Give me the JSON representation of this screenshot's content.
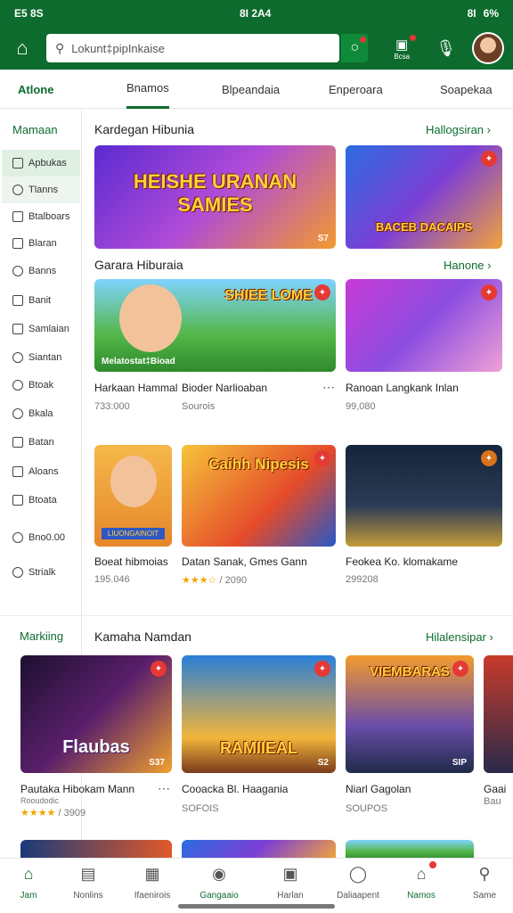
{
  "status": {
    "left": "E5 8S",
    "center": "8I 2A4",
    "right_signal": "8I",
    "battery": "6%"
  },
  "appbar": {
    "search_placeholder": "Lokunt‡pipInkaise",
    "app_label": "Bcsa"
  },
  "tabs": [
    "Atlone",
    "Bnamos",
    "Blpeandaia",
    "Enperoara",
    "Soapekaa"
  ],
  "sidebar": {
    "title": "Mamaan",
    "items": [
      "Apbukas",
      "Tlanns",
      "Btalboars",
      "Blaran",
      "Banns",
      "Banit",
      "Samlaian",
      "Siantan",
      "Btoak",
      "Bkala",
      "Batan",
      "Aloans",
      "Btoata",
      "Bno0.00",
      "Strialk"
    ],
    "bottom_title": "Markiing"
  },
  "sections": {
    "s1": {
      "title": "Kardegan Hibunia",
      "link": "Hallogsiran"
    },
    "s2": {
      "title": "Garara Hiburaia",
      "link": "Hanone"
    },
    "s3": {
      "title": "Kamaha Namdan",
      "link": "Hilalensipar"
    }
  },
  "cards": {
    "c1_text": "HEISHE URANAN SAMIES",
    "c1_tag": "S7",
    "c2_text": "BACEB DACAIPS",
    "c3_text": "SHIEE LOME",
    "c3_caption": "Melatostat‡Bioad",
    "c5_caption": "LIUONGAINOIT",
    "c6_text": "Caihh Nipesis",
    "c9_text": "Flaubas",
    "c9_tag": "S37",
    "c10_text": "RAMIIEAL",
    "c10_tag": "S2",
    "c11_text": "VIEMBARAS",
    "c11_tag": "SIP"
  },
  "games": [
    {
      "title": "Harkaan Hammal",
      "sub": "733:000"
    },
    {
      "title": "Bioder Narlioaban",
      "sub": "Sourois"
    },
    {
      "title": "Ranoan Langkank Inlan",
      "sub": "99,080"
    },
    {
      "title": "Boeat hibmoias",
      "sub": "195.046"
    },
    {
      "title": "Datan Sanak, Gmes Gann",
      "sub": "/ 2090"
    },
    {
      "title": "Feokea Ko. klomakame",
      "sub": "299208"
    },
    {
      "title": "Pautaka Hibokam Mann",
      "sub": "Rooudodic",
      "rating": "/ 3909"
    },
    {
      "title": "Cooacka Bl. Haagania",
      "sub": "SOFOIS"
    },
    {
      "title": "Niarl Gagolan",
      "sub": "SOUPOS"
    },
    {
      "title": "Gaai",
      "sub": "Bau"
    }
  ],
  "bottomnav": [
    "Jam",
    "Nonlins",
    "Ifaenirois",
    "Gangaaio",
    "Harlan",
    "Daliaapent",
    "Namos",
    "Same"
  ],
  "colors": {
    "brand": "#0d6b2d",
    "badge": "#e53935"
  }
}
